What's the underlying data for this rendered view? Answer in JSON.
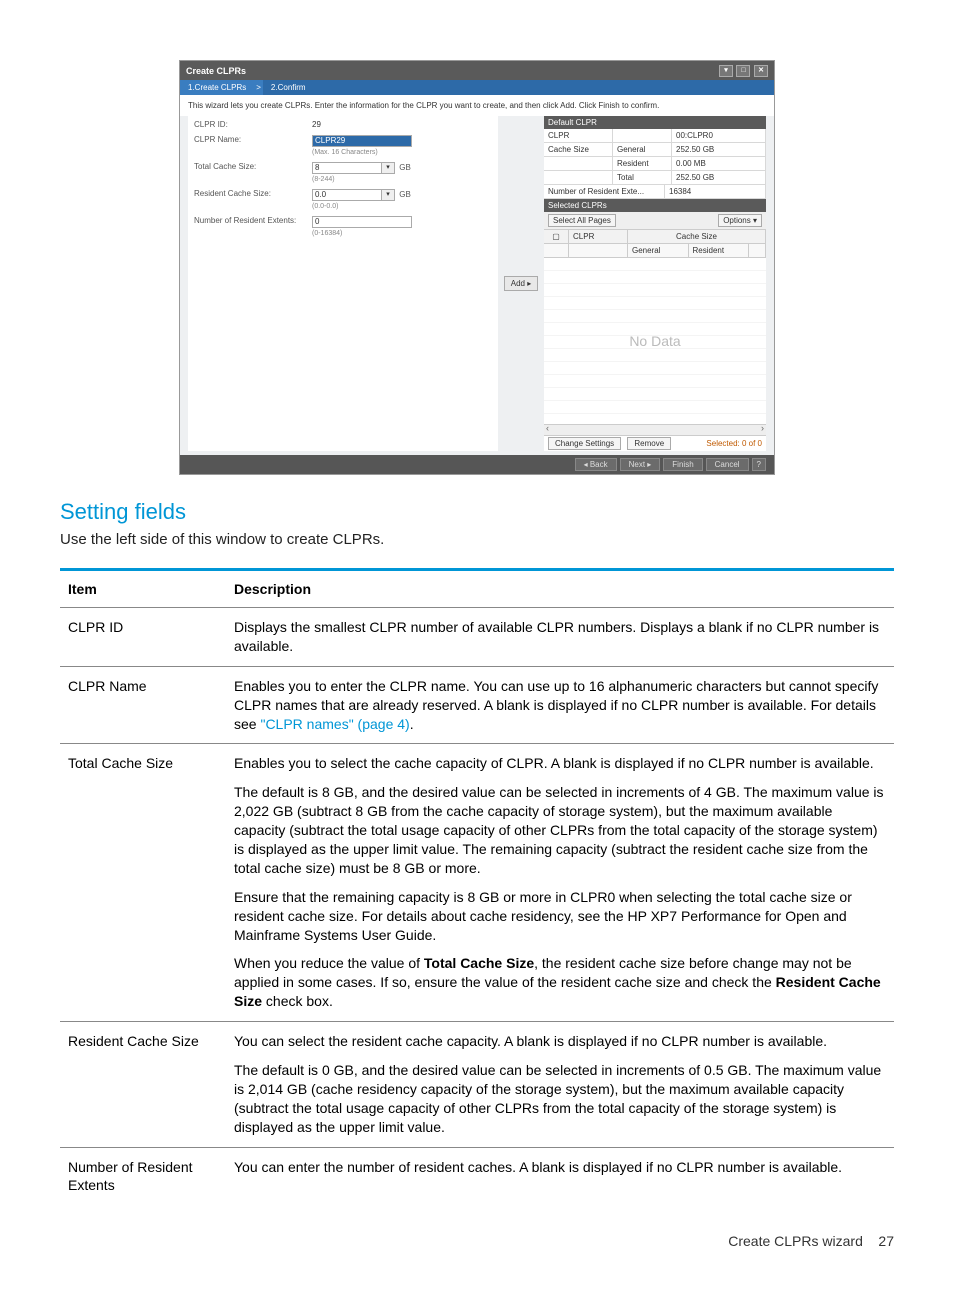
{
  "wizard": {
    "title": "Create CLPRs",
    "steps": {
      "s1": "1.Create CLPRs",
      "sep": ">",
      "s2": "2.Confirm"
    },
    "desc": "This wizard lets you create CLPRs. Enter the information for the CLPR you want to create, and then click Add. Click Finish to confirm.",
    "left": {
      "clpr_id_label": "CLPR ID:",
      "clpr_id_value": "29",
      "clpr_name_label": "CLPR Name:",
      "clpr_name_value": "CLPR29",
      "clpr_name_hint": "(Max. 16 Characters)",
      "total_cache_label": "Total Cache Size:",
      "total_cache_value": "8",
      "total_cache_hint": "(8-244)",
      "resident_cache_label": "Resident Cache Size:",
      "resident_cache_value": "0.0",
      "resident_cache_hint": "(0.0-0.0)",
      "resident_extents_label": "Number of Resident Extents:",
      "resident_extents_value": "0",
      "resident_extents_hint": "(0-16384)",
      "unit": "GB"
    },
    "add": "Add ▸",
    "right": {
      "default_title": "Default CLPR",
      "def_clpr": "CLPR",
      "def_clpr_val": "00:CLPR0",
      "def_cache": "Cache Size",
      "def_general": "General",
      "def_general_val": "252.50 GB",
      "def_resident": "Resident",
      "def_resident_val": "0.00 MB",
      "def_total": "Total",
      "def_total_val": "252.50 GB",
      "def_extents": "Number of Resident Exte...",
      "def_extents_val": "16384",
      "selected_title": "Selected CLPRs",
      "select_all": "Select All Pages",
      "options": "Options ▾",
      "col_clpr": "CLPR",
      "col_cache": "Cache Size",
      "col_general": "General",
      "col_resident": "Resident",
      "no_data": "No Data",
      "change_settings": "Change Settings",
      "remove": "Remove",
      "selected_status": "Selected:  0   of  0"
    },
    "footer": {
      "back": "◂ Back",
      "next": "Next ▸",
      "finish": "Finish",
      "cancel": "Cancel",
      "help": "?"
    }
  },
  "section": {
    "title": "Setting fields",
    "desc": "Use the left side of this window to create CLPRs."
  },
  "table": {
    "head_item": "Item",
    "head_desc": "Description",
    "rows": {
      "r1_item": "CLPR ID",
      "r1_desc": "Displays the smallest CLPR number of available CLPR numbers. Displays a blank if no CLPR number is available.",
      "r2_item": "CLPR Name",
      "r2_desc_a": "Enables you to enter the CLPR name. You can use up to 16 alphanumeric characters but cannot specify CLPR names that are already reserved. A blank is displayed if no CLPR number is available. For details see ",
      "r2_link": "\"CLPR names\" (page 4)",
      "r2_desc_b": ".",
      "r3_item": "Total Cache Size",
      "r3_p1": "Enables you to select the cache capacity of CLPR. A blank is displayed if no CLPR number is available.",
      "r3_p2": "The default is 8 GB, and the desired value can be selected in increments of 4 GB. The maximum value is 2,022 GB (subtract 8 GB from the cache capacity of storage system), but the maximum available capacity (subtract the total usage capacity of other CLPRs from the total capacity of the storage system) is displayed as the upper limit value. The remaining capacity (subtract the resident cache size from the total cache size) must be 8 GB or more.",
      "r3_p3": "Ensure that the remaining capacity is 8 GB or more in CLPR0 when selecting the total cache size or resident cache size. For details about cache residency, see the HP XP7 Performance for Open and Mainframe Systems User Guide.",
      "r3_p4a": "When you reduce the value of ",
      "r3_p4b": "Total Cache Size",
      "r3_p4c": ", the resident cache size before change may not be applied in some cases. If so, ensure the value of the resident cache size and check the ",
      "r3_p4d": "Resident Cache Size",
      "r3_p4e": " check box.",
      "r4_item": "Resident Cache Size",
      "r4_p1": "You can select the resident cache capacity. A blank is displayed if no CLPR number is available.",
      "r4_p2": "The default is 0 GB, and the desired value can be selected in increments of 0.5 GB. The maximum value is 2,014 GB (cache residency capacity of the storage system), but the maximum available capacity (subtract the total usage capacity of other CLPRs from the total capacity of the storage system) is displayed as the upper limit value.",
      "r5_item": "Number of Resident Extents",
      "r5_desc": "You can enter the number of resident caches. A blank is displayed if no CLPR number is available."
    }
  },
  "footer": {
    "label": "Create CLPRs wizard",
    "page": "27"
  }
}
